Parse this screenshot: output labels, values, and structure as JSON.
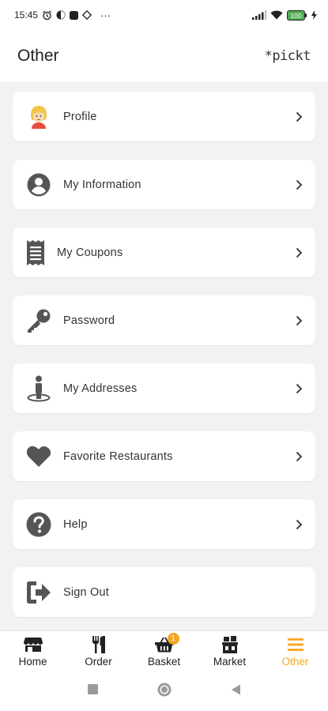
{
  "status_bar": {
    "time": "15:45",
    "dots": "···",
    "battery": "100"
  },
  "header": {
    "title": "Other",
    "brand": "*pickt"
  },
  "menu": {
    "items": [
      {
        "label": "Profile",
        "icon": "avatar-icon"
      },
      {
        "label": "My Information",
        "icon": "account-circle-icon"
      },
      {
        "label": "My Coupons",
        "icon": "receipt-icon"
      },
      {
        "label": "Password",
        "icon": "key-icon"
      },
      {
        "label": "My Addresses",
        "icon": "person-pin-icon"
      },
      {
        "label": "Favorite Restaurants",
        "icon": "heart-icon"
      },
      {
        "label": "Help",
        "icon": "help-icon"
      },
      {
        "label": "Sign Out",
        "icon": "sign-out-icon"
      }
    ]
  },
  "bottom_nav": {
    "items": [
      {
        "label": "Home",
        "icon": "store-icon"
      },
      {
        "label": "Order",
        "icon": "cutlery-icon"
      },
      {
        "label": "Basket",
        "icon": "basket-icon",
        "badge": "1"
      },
      {
        "label": "Market",
        "icon": "market-icon"
      },
      {
        "label": "Other",
        "icon": "hamburger-menu-icon",
        "active": true
      }
    ]
  },
  "colors": {
    "accent": "#f5a623",
    "icon_gray": "#555555",
    "background": "#f2f2f2"
  }
}
